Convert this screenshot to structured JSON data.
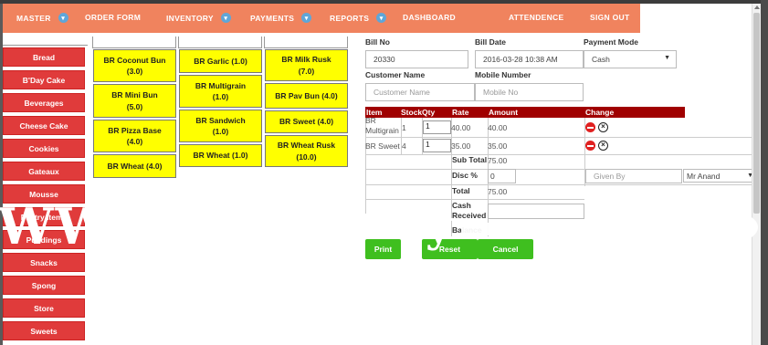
{
  "nav": {
    "items": [
      {
        "label": "MASTER",
        "dropdown": true
      },
      {
        "label": "ORDER FORM",
        "dropdown": false
      },
      {
        "label": "INVENTORY",
        "dropdown": true
      },
      {
        "label": "PAYMENTS",
        "dropdown": true
      },
      {
        "label": "REPORTS",
        "dropdown": true
      },
      {
        "label": "DASHBOARD",
        "dropdown": false
      },
      {
        "label": "ATTENDENCE",
        "dropdown": false
      },
      {
        "label": "SIGN OUT",
        "dropdown": false
      }
    ],
    "dropdown_glyph": "▾"
  },
  "sidebar": {
    "categories": [
      "Bread",
      "B'Day Cake",
      "Beverages",
      "Cheese Cake",
      "Cookies",
      "Gateaux",
      "Mousse",
      "Pastry Items",
      "Puddings",
      "Snacks",
      "Spong",
      "Store",
      "Sweets"
    ]
  },
  "products": {
    "col1": [
      {
        "name": "BR Coconut Bun",
        "price": "(3.0)"
      },
      {
        "name": "BR Mini Bun",
        "price": "(5.0)"
      },
      {
        "name": "BR Pizza Base",
        "price": "(4.0)"
      },
      {
        "name": "BR Wheat",
        "price": "(4.0)"
      }
    ],
    "col2": [
      {
        "name": "BR Garlic",
        "price": "(1.0)"
      },
      {
        "name": "BR Multigrain",
        "price": "(1.0)"
      },
      {
        "name": "BR Sandwich",
        "price": "(1.0)"
      },
      {
        "name": "BR Wheat",
        "price": "(1.0)"
      }
    ],
    "col3": [
      {
        "name": "BR Milk Rusk",
        "price": "(7.0)"
      },
      {
        "name": "BR Pav Bun",
        "price": "(4.0)"
      },
      {
        "name": "BR Sweet",
        "price": "(4.0)"
      },
      {
        "name": "BR Wheat Rusk",
        "price": "(10.0)"
      }
    ]
  },
  "bill": {
    "bill_no_label": "Bill No",
    "bill_no": "20330",
    "bill_date_label": "Bill Date",
    "bill_date": "2016-03-28 10:38 AM",
    "payment_mode_label": "Payment Mode",
    "payment_mode": "Cash",
    "customer_name_label": "Customer Name",
    "customer_name_placeholder": "Customer Name",
    "mobile_label": "Mobile Number",
    "mobile_placeholder": "Mobile No"
  },
  "table": {
    "headers": [
      "Item",
      "Stock",
      "Qty",
      "Rate",
      "Amount",
      "Change"
    ],
    "rows": [
      {
        "item_line1": "BR",
        "item_line2": "Multigrain",
        "stock": "1",
        "qty": "1",
        "rate": "40.00",
        "amount": "40.00"
      },
      {
        "item_line1": "BR Sweet",
        "item_line2": "",
        "stock": "4",
        "qty": "1",
        "rate": "35.00",
        "amount": "35.00"
      }
    ]
  },
  "summary": {
    "subtotal_label": "Sub Total",
    "subtotal": "75.00",
    "disc_label": "Disc %",
    "disc": "0",
    "total_label": "Total",
    "total": "75.00",
    "cash_received_label": "Cash Received",
    "balance_label": "Balance",
    "given_by_placeholder": "Given By",
    "staff": "Mr Anand"
  },
  "buttons": {
    "print": "Print",
    "reset": "Reset",
    "cancel": "Cancel"
  },
  "colors": {
    "nav_bg": "#f0835e",
    "category_red": "#e03b3b",
    "product_yellow": "#ffff00",
    "table_header": "#a00000",
    "button_green": "#3fbf1f"
  }
}
